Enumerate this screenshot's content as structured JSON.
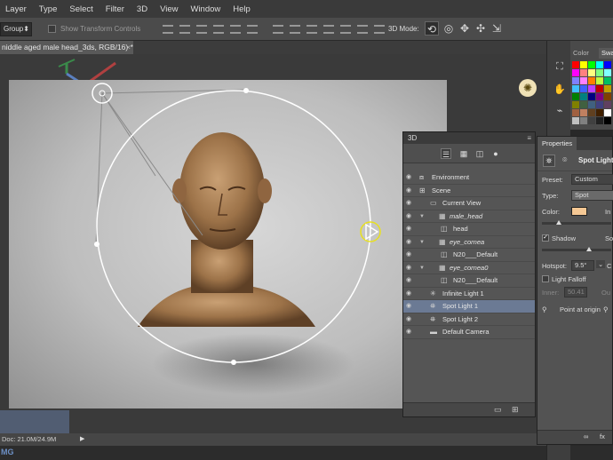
{
  "menu": [
    "Layer",
    "Type",
    "Select",
    "Filter",
    "3D",
    "View",
    "Window",
    "Help"
  ],
  "options": {
    "group_select": "Group",
    "transform_controls_label": "Show Transform Controls",
    "mode_label": "3D Mode:"
  },
  "document": {
    "tab_title": "niddle aged male head_3ds, RGB/16) *",
    "close": "×"
  },
  "status": {
    "doc_size": "Doc: 21.0M/24.9M",
    "play": "▶"
  },
  "watermark": "MG",
  "color_panel": {
    "tabs": [
      "Color",
      "Swa"
    ],
    "swatches": [
      "#ff0000",
      "#ffff00",
      "#00ff00",
      "#00ffff",
      "#0000ff",
      "#ff00ff",
      "#ff8080",
      "#ffff80",
      "#80ff80",
      "#80ffff",
      "#8080ff",
      "#ff80ff",
      "#ff8000",
      "#c0ff40",
      "#00c060",
      "#40c0ff",
      "#4060ff",
      "#c040ff",
      "#c00000",
      "#c0a000",
      "#008000",
      "#008080",
      "#000080",
      "#800080",
      "#804000",
      "#808000",
      "#406040",
      "#406080",
      "#404080",
      "#604060",
      "#a06040",
      "#c08060",
      "#604020",
      "#402000",
      "#ffffff",
      "#c0c0c0",
      "#808080",
      "#404040",
      "#202020",
      "#000000"
    ]
  },
  "panel3d": {
    "title": "3D",
    "rows": [
      {
        "label": "Environment",
        "icon": "environment-icon",
        "glyph": "⧈",
        "indent": 0,
        "twirl": false,
        "italic": false,
        "selected": false
      },
      {
        "label": "Scene",
        "icon": "scene-icon",
        "glyph": "⊞",
        "indent": 0,
        "twirl": false,
        "italic": false,
        "selected": false
      },
      {
        "label": "Current View",
        "icon": "camera-view-icon",
        "glyph": "▭",
        "indent": 1,
        "twirl": false,
        "italic": false,
        "selected": false
      },
      {
        "label": "male_head",
        "icon": "mesh-icon",
        "glyph": "▦",
        "indent": 1,
        "twirl": true,
        "italic": true,
        "selected": false
      },
      {
        "label": "head",
        "icon": "material-icon",
        "glyph": "◫",
        "indent": 2,
        "twirl": false,
        "italic": false,
        "selected": false
      },
      {
        "label": "eye_cornea",
        "icon": "mesh-icon",
        "glyph": "▦",
        "indent": 1,
        "twirl": true,
        "italic": true,
        "selected": false
      },
      {
        "label": "N20___Default",
        "icon": "material-icon",
        "glyph": "◫",
        "indent": 2,
        "twirl": false,
        "italic": false,
        "selected": false
      },
      {
        "label": "eye_cornea0",
        "icon": "mesh-icon",
        "glyph": "▦",
        "indent": 1,
        "twirl": true,
        "italic": true,
        "selected": false
      },
      {
        "label": "N20___Default",
        "icon": "material-icon",
        "glyph": "◫",
        "indent": 2,
        "twirl": false,
        "italic": false,
        "selected": false
      },
      {
        "label": "Infinite Light 1",
        "icon": "infinite-light-icon",
        "glyph": "✳",
        "indent": 1,
        "twirl": false,
        "italic": false,
        "selected": false
      },
      {
        "label": "Spot Light 1",
        "icon": "spot-light-icon",
        "glyph": "⛯",
        "indent": 1,
        "twirl": false,
        "italic": false,
        "selected": true
      },
      {
        "label": "Spot Light 2",
        "icon": "spot-light-icon",
        "glyph": "⛯",
        "indent": 1,
        "twirl": false,
        "italic": false,
        "selected": false
      },
      {
        "label": "Default Camera",
        "icon": "camera-icon",
        "glyph": "▬",
        "indent": 1,
        "twirl": false,
        "italic": false,
        "selected": false
      }
    ]
  },
  "properties": {
    "tab": "Properties",
    "name": "Spot Light",
    "preset_label": "Preset:",
    "preset_value": "Custom",
    "type_label": "Type:",
    "type_value": "Spot",
    "color_label": "Color:",
    "intensity_label": "In",
    "color_value": "#f5c894",
    "shadow_label": "Shadow",
    "softness_label": "So",
    "hotspot_label": "Hotspot:",
    "hotspot_value": "9.5°",
    "cone_label": "C",
    "falloff_label": "Light Falloff",
    "inner_label": "Inner:",
    "inner_value": "50.41",
    "outer_label": "Ou",
    "point_origin": "Point at origin"
  }
}
